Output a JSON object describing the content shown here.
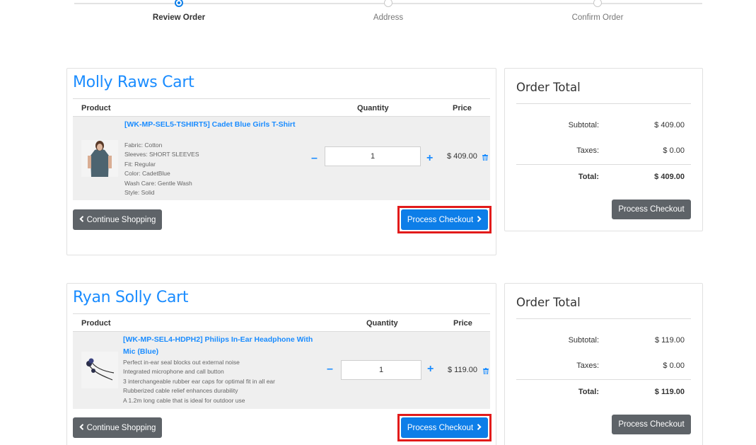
{
  "steps": [
    {
      "label": "Review Order",
      "active": true
    },
    {
      "label": "Address",
      "active": false
    },
    {
      "label": "Confirm Order",
      "active": false
    }
  ],
  "carts": [
    {
      "title": "Molly Raws Cart",
      "headers": {
        "product": "Product",
        "quantity": "Quantity",
        "price": "Price"
      },
      "item": {
        "name": "[WK-MP-SEL5-TSHIRT5] Cadet Blue Girls T-Shirt",
        "details": [
          "Fabric: Cotton",
          "Sleeves: SHORT SLEEVES",
          "Fit: Regular",
          "Color: CadetBlue",
          "Wash Care: Gentle Wash",
          "Style: Solid"
        ],
        "quantity": "1",
        "price": "$ 409.00"
      },
      "continue_label": "Continue Shopping",
      "checkout_label": "Process Checkout",
      "order_total": {
        "title": "Order Total",
        "subtotal_label": "Subtotal:",
        "subtotal": "$ 409.00",
        "taxes_label": "Taxes:",
        "taxes": "$ 0.00",
        "total_label": "Total:",
        "total": "$ 409.00",
        "checkout_label": "Process Checkout"
      }
    },
    {
      "title": "Ryan Solly Cart",
      "headers": {
        "product": "Product",
        "quantity": "Quantity",
        "price": "Price"
      },
      "item": {
        "name_line1": "[WK-MP-SEL4-HDPH2] Philips In-Ear Headphone With",
        "name_line2": "Mic (Blue)",
        "details": [
          "Perfect in-ear seal blocks out external noise",
          "Integrated microphone and call button",
          "3 interchangeable rubber ear caps for optimal fit in all ear",
          "Rubberized cable relief enhances durability",
          "A 1.2m long cable that is ideal for outdoor use"
        ],
        "quantity": "1",
        "price": "$ 119.00"
      },
      "continue_label": "Continue Shopping",
      "checkout_label": "Process Checkout",
      "order_total": {
        "title": "Order Total",
        "subtotal_label": "Subtotal:",
        "subtotal": "$ 119.00",
        "taxes_label": "Taxes:",
        "taxes": "$ 0.00",
        "total_label": "Total:",
        "total": "$ 119.00",
        "checkout_label": "Process Checkout"
      }
    }
  ],
  "colors": {
    "accent": "#0d7ee8",
    "link": "#1a8cff",
    "highlight": "#e21b1b",
    "secondary_button": "#5e6368"
  },
  "icons": {
    "continue": "chevron-left-icon",
    "checkout": "chevron-right-icon",
    "remove": "trash-icon"
  }
}
